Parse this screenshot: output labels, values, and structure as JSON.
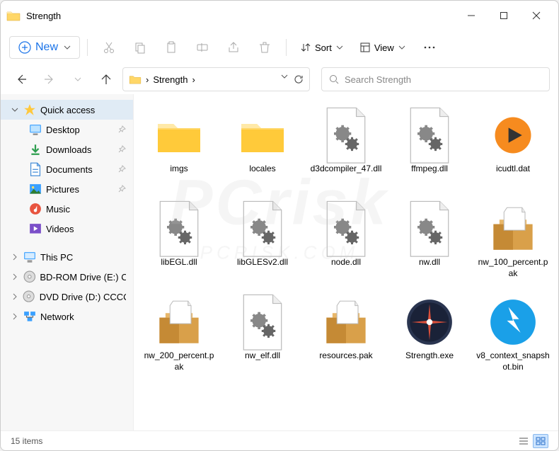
{
  "window": {
    "title": "Strength"
  },
  "toolbar": {
    "new_label": "New",
    "sort_label": "Sort",
    "view_label": "View"
  },
  "breadcrumb": {
    "items": [
      "Strength"
    ],
    "chevron": "›"
  },
  "search": {
    "placeholder": "Search Strength"
  },
  "sidebar": {
    "quick_access": "Quick access",
    "items": [
      {
        "label": "Desktop",
        "icon": "desktop",
        "pinned": true
      },
      {
        "label": "Downloads",
        "icon": "downloads",
        "pinned": true
      },
      {
        "label": "Documents",
        "icon": "documents",
        "pinned": true
      },
      {
        "label": "Pictures",
        "icon": "pictures",
        "pinned": true
      },
      {
        "label": "Music",
        "icon": "music",
        "pinned": false
      },
      {
        "label": "Videos",
        "icon": "videos",
        "pinned": false
      }
    ],
    "roots": [
      {
        "label": "This PC",
        "icon": "pc"
      },
      {
        "label": "BD-ROM Drive (E:) C",
        "icon": "disc"
      },
      {
        "label": "DVD Drive (D:) CCCC",
        "icon": "disc"
      },
      {
        "label": "Network",
        "icon": "network"
      }
    ]
  },
  "files": [
    {
      "name": "imgs",
      "type": "folder"
    },
    {
      "name": "locales",
      "type": "folder"
    },
    {
      "name": "d3dcompiler_47.dll",
      "type": "dll"
    },
    {
      "name": "ffmpeg.dll",
      "type": "dll"
    },
    {
      "name": "icudtl.dat",
      "type": "media"
    },
    {
      "name": "libEGL.dll",
      "type": "dll"
    },
    {
      "name": "libGLESv2.dll",
      "type": "dll"
    },
    {
      "name": "node.dll",
      "type": "dll"
    },
    {
      "name": "nw.dll",
      "type": "dll"
    },
    {
      "name": "nw_100_percent.pak",
      "type": "pak"
    },
    {
      "name": "nw_200_percent.pak",
      "type": "pak"
    },
    {
      "name": "nw_elf.dll",
      "type": "dll"
    },
    {
      "name": "resources.pak",
      "type": "pak"
    },
    {
      "name": "Strength.exe",
      "type": "exe"
    },
    {
      "name": "v8_context_snapshot.bin",
      "type": "bin"
    }
  ],
  "status": {
    "count_text": "15 items"
  }
}
